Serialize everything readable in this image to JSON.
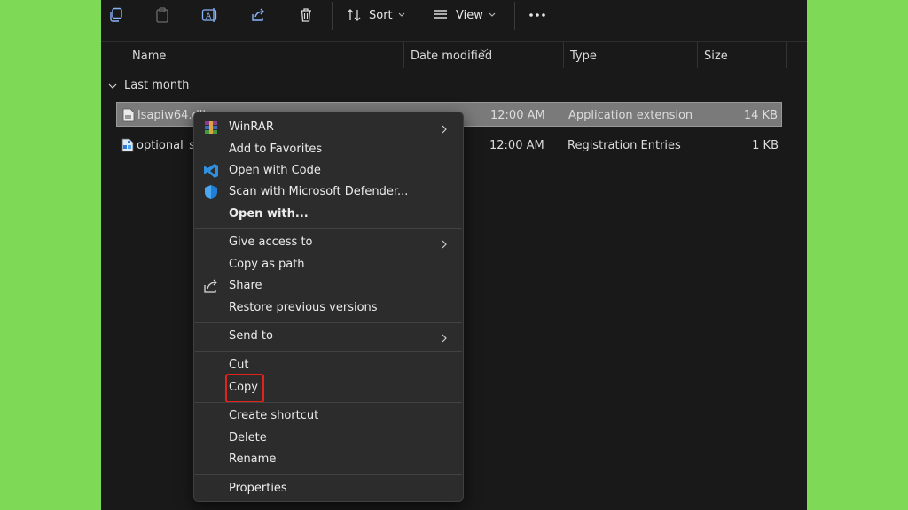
{
  "toolbar": {
    "sort_label": "Sort",
    "view_label": "View",
    "icons": [
      "copy-icon",
      "paste-icon",
      "rename-icon",
      "share-icon",
      "delete-icon",
      "sort-icon",
      "view-icon",
      "more-icon"
    ]
  },
  "columns": {
    "name": "Name",
    "date": "Date modified",
    "type": "Type",
    "size": "Size"
  },
  "group": {
    "label": "Last month"
  },
  "files": [
    {
      "name": "lsapiw64.dll",
      "date": "12:00 AM",
      "type": "Application extension",
      "size": "14 KB"
    },
    {
      "name": "optional_s",
      "date": "12:00 AM",
      "type": "Registration Entries",
      "size": "1 KB"
    }
  ],
  "context_menu": {
    "winrar": "WinRAR",
    "add_favorites": "Add to Favorites",
    "open_code": "Open with Code",
    "scan_defender": "Scan with Microsoft Defender...",
    "open_with": "Open with...",
    "give_access": "Give access to",
    "copy_path": "Copy as path",
    "share": "Share",
    "restore": "Restore previous versions",
    "send_to": "Send to",
    "cut": "Cut",
    "copy": "Copy",
    "create_shortcut": "Create shortcut",
    "delete": "Delete",
    "rename": "Rename",
    "properties": "Properties"
  },
  "colors": {
    "background": "#7ed957",
    "window": "#191919",
    "menu": "#2c2c2c",
    "selected_row": "#7a7a7a",
    "highlight_box": "#e0241b",
    "vscode_blue": "#2f8fe0",
    "defender_blue": "#1f7fd6"
  }
}
